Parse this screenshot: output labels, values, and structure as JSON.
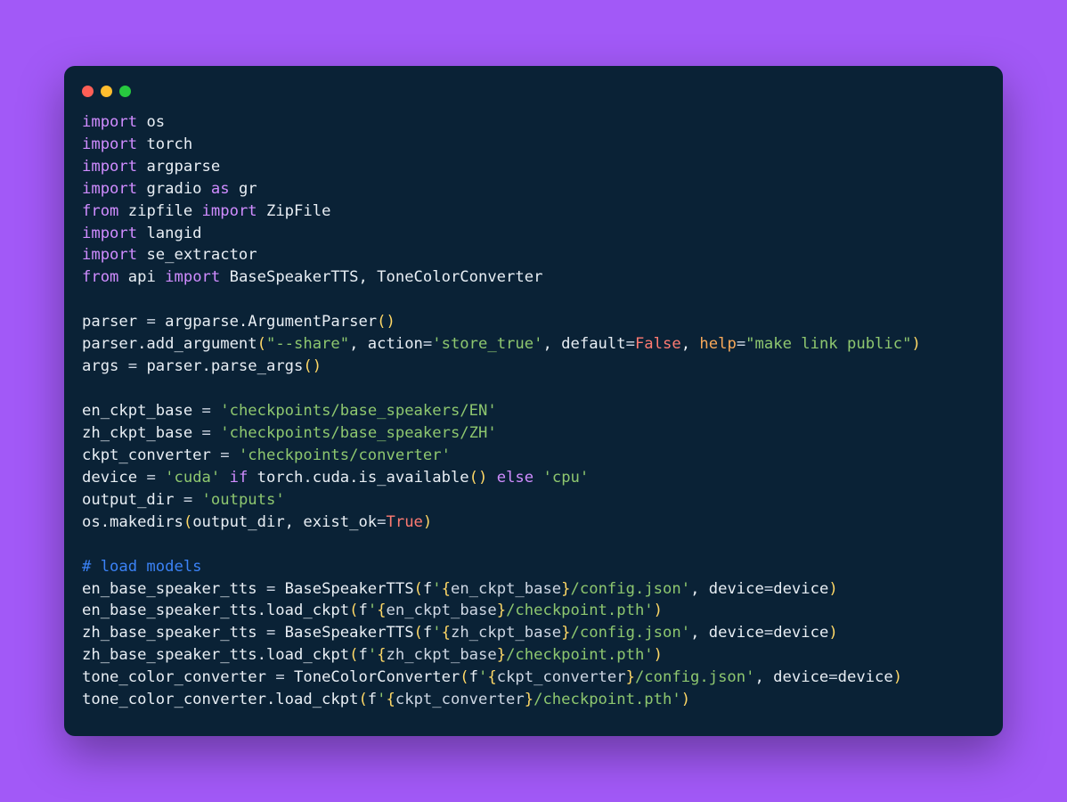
{
  "window": {
    "controls": [
      "close",
      "minimize",
      "zoom"
    ]
  },
  "code": {
    "lines": [
      [
        {
          "c": "kw",
          "t": "import"
        },
        {
          "c": "id",
          "t": " os"
        }
      ],
      [
        {
          "c": "kw",
          "t": "import"
        },
        {
          "c": "id",
          "t": " torch"
        }
      ],
      [
        {
          "c": "kw",
          "t": "import"
        },
        {
          "c": "id",
          "t": " argparse"
        }
      ],
      [
        {
          "c": "kw",
          "t": "import"
        },
        {
          "c": "id",
          "t": " gradio "
        },
        {
          "c": "kw",
          "t": "as"
        },
        {
          "c": "id",
          "t": " gr"
        }
      ],
      [
        {
          "c": "kw",
          "t": "from"
        },
        {
          "c": "id",
          "t": " zipfile "
        },
        {
          "c": "kw",
          "t": "import"
        },
        {
          "c": "id",
          "t": " ZipFile"
        }
      ],
      [
        {
          "c": "kw",
          "t": "import"
        },
        {
          "c": "id",
          "t": " langid"
        }
      ],
      [
        {
          "c": "kw",
          "t": "import"
        },
        {
          "c": "id",
          "t": " se_extractor"
        }
      ],
      [
        {
          "c": "kw",
          "t": "from"
        },
        {
          "c": "id",
          "t": " api "
        },
        {
          "c": "kw",
          "t": "import"
        },
        {
          "c": "id",
          "t": " BaseSpeakerTTS, ToneColorConverter"
        }
      ],
      [],
      [
        {
          "c": "id",
          "t": "parser "
        },
        {
          "c": "op",
          "t": "="
        },
        {
          "c": "id",
          "t": " argparse.ArgumentParser"
        },
        {
          "c": "paren",
          "t": "()"
        }
      ],
      [
        {
          "c": "id",
          "t": "parser.add_argument"
        },
        {
          "c": "paren",
          "t": "("
        },
        {
          "c": "str",
          "t": "\"--share\""
        },
        {
          "c": "id",
          "t": ", action"
        },
        {
          "c": "op",
          "t": "="
        },
        {
          "c": "str",
          "t": "'store_true'"
        },
        {
          "c": "id",
          "t": ", default"
        },
        {
          "c": "op",
          "t": "="
        },
        {
          "c": "numF",
          "t": "False"
        },
        {
          "c": "id",
          "t": ", "
        },
        {
          "c": "argn",
          "t": "help"
        },
        {
          "c": "op",
          "t": "="
        },
        {
          "c": "str",
          "t": "\"make link public\""
        },
        {
          "c": "paren",
          "t": ")"
        }
      ],
      [
        {
          "c": "id",
          "t": "args "
        },
        {
          "c": "op",
          "t": "="
        },
        {
          "c": "id",
          "t": " parser.parse_args"
        },
        {
          "c": "paren",
          "t": "()"
        }
      ],
      [],
      [
        {
          "c": "id",
          "t": "en_ckpt_base "
        },
        {
          "c": "op",
          "t": "="
        },
        {
          "c": "id",
          "t": " "
        },
        {
          "c": "str",
          "t": "'checkpoints/base_speakers/EN'"
        }
      ],
      [
        {
          "c": "id",
          "t": "zh_ckpt_base "
        },
        {
          "c": "op",
          "t": "="
        },
        {
          "c": "id",
          "t": " "
        },
        {
          "c": "str",
          "t": "'checkpoints/base_speakers/ZH'"
        }
      ],
      [
        {
          "c": "id",
          "t": "ckpt_converter "
        },
        {
          "c": "op",
          "t": "="
        },
        {
          "c": "id",
          "t": " "
        },
        {
          "c": "str",
          "t": "'checkpoints/converter'"
        }
      ],
      [
        {
          "c": "id",
          "t": "device "
        },
        {
          "c": "op",
          "t": "="
        },
        {
          "c": "id",
          "t": " "
        },
        {
          "c": "str",
          "t": "'cuda'"
        },
        {
          "c": "id",
          "t": " "
        },
        {
          "c": "kw",
          "t": "if"
        },
        {
          "c": "id",
          "t": " torch.cuda.is_available"
        },
        {
          "c": "paren",
          "t": "()"
        },
        {
          "c": "id",
          "t": " "
        },
        {
          "c": "kw",
          "t": "else"
        },
        {
          "c": "id",
          "t": " "
        },
        {
          "c": "str",
          "t": "'cpu'"
        }
      ],
      [
        {
          "c": "id",
          "t": "output_dir "
        },
        {
          "c": "op",
          "t": "="
        },
        {
          "c": "id",
          "t": " "
        },
        {
          "c": "str",
          "t": "'outputs'"
        }
      ],
      [
        {
          "c": "id",
          "t": "os.makedirs"
        },
        {
          "c": "paren",
          "t": "("
        },
        {
          "c": "id",
          "t": "output_dir, exist_ok"
        },
        {
          "c": "op",
          "t": "="
        },
        {
          "c": "numT",
          "t": "True"
        },
        {
          "c": "paren",
          "t": ")"
        }
      ],
      [],
      [
        {
          "c": "cmt",
          "t": "# load models"
        }
      ],
      [
        {
          "c": "id",
          "t": "en_base_speaker_tts "
        },
        {
          "c": "op",
          "t": "="
        },
        {
          "c": "id",
          "t": " BaseSpeakerTTS"
        },
        {
          "c": "paren",
          "t": "("
        },
        {
          "c": "id",
          "t": "f"
        },
        {
          "c": "str",
          "t": "'"
        },
        {
          "c": "brace",
          "t": "{"
        },
        {
          "c": "intp",
          "t": "en_ckpt_base"
        },
        {
          "c": "brace",
          "t": "}"
        },
        {
          "c": "str",
          "t": "/config.json'"
        },
        {
          "c": "id",
          "t": ", device"
        },
        {
          "c": "op",
          "t": "="
        },
        {
          "c": "id",
          "t": "device"
        },
        {
          "c": "paren",
          "t": ")"
        }
      ],
      [
        {
          "c": "id",
          "t": "en_base_speaker_tts.load_ckpt"
        },
        {
          "c": "paren",
          "t": "("
        },
        {
          "c": "id",
          "t": "f"
        },
        {
          "c": "str",
          "t": "'"
        },
        {
          "c": "brace",
          "t": "{"
        },
        {
          "c": "intp",
          "t": "en_ckpt_base"
        },
        {
          "c": "brace",
          "t": "}"
        },
        {
          "c": "str",
          "t": "/checkpoint.pth'"
        },
        {
          "c": "paren",
          "t": ")"
        }
      ],
      [
        {
          "c": "id",
          "t": "zh_base_speaker_tts "
        },
        {
          "c": "op",
          "t": "="
        },
        {
          "c": "id",
          "t": " BaseSpeakerTTS"
        },
        {
          "c": "paren",
          "t": "("
        },
        {
          "c": "id",
          "t": "f"
        },
        {
          "c": "str",
          "t": "'"
        },
        {
          "c": "brace",
          "t": "{"
        },
        {
          "c": "intp",
          "t": "zh_ckpt_base"
        },
        {
          "c": "brace",
          "t": "}"
        },
        {
          "c": "str",
          "t": "/config.json'"
        },
        {
          "c": "id",
          "t": ", device"
        },
        {
          "c": "op",
          "t": "="
        },
        {
          "c": "id",
          "t": "device"
        },
        {
          "c": "paren",
          "t": ")"
        }
      ],
      [
        {
          "c": "id",
          "t": "zh_base_speaker_tts.load_ckpt"
        },
        {
          "c": "paren",
          "t": "("
        },
        {
          "c": "id",
          "t": "f"
        },
        {
          "c": "str",
          "t": "'"
        },
        {
          "c": "brace",
          "t": "{"
        },
        {
          "c": "intp",
          "t": "zh_ckpt_base"
        },
        {
          "c": "brace",
          "t": "}"
        },
        {
          "c": "str",
          "t": "/checkpoint.pth'"
        },
        {
          "c": "paren",
          "t": ")"
        }
      ],
      [
        {
          "c": "id",
          "t": "tone_color_converter "
        },
        {
          "c": "op",
          "t": "="
        },
        {
          "c": "id",
          "t": " ToneColorConverter"
        },
        {
          "c": "paren",
          "t": "("
        },
        {
          "c": "id",
          "t": "f"
        },
        {
          "c": "str",
          "t": "'"
        },
        {
          "c": "brace",
          "t": "{"
        },
        {
          "c": "intp",
          "t": "ckpt_converter"
        },
        {
          "c": "brace",
          "t": "}"
        },
        {
          "c": "str",
          "t": "/config.json'"
        },
        {
          "c": "id",
          "t": ", device"
        },
        {
          "c": "op",
          "t": "="
        },
        {
          "c": "id",
          "t": "device"
        },
        {
          "c": "paren",
          "t": ")"
        }
      ],
      [
        {
          "c": "id",
          "t": "tone_color_converter.load_ckpt"
        },
        {
          "c": "paren",
          "t": "("
        },
        {
          "c": "id",
          "t": "f"
        },
        {
          "c": "str",
          "t": "'"
        },
        {
          "c": "brace",
          "t": "{"
        },
        {
          "c": "intp",
          "t": "ckpt_converter"
        },
        {
          "c": "brace",
          "t": "}"
        },
        {
          "c": "str",
          "t": "/checkpoint.pth'"
        },
        {
          "c": "paren",
          "t": ")"
        }
      ]
    ]
  },
  "colors": {
    "page_bg": "#a259f7",
    "window_bg": "#0a2236",
    "keyword": "#d08cff",
    "string": "#8ec76f",
    "literal": "#ff7b72",
    "argname": "#f9a959",
    "comment": "#3b82f6",
    "brace": "#ffd866",
    "text": "#eef2f6"
  }
}
